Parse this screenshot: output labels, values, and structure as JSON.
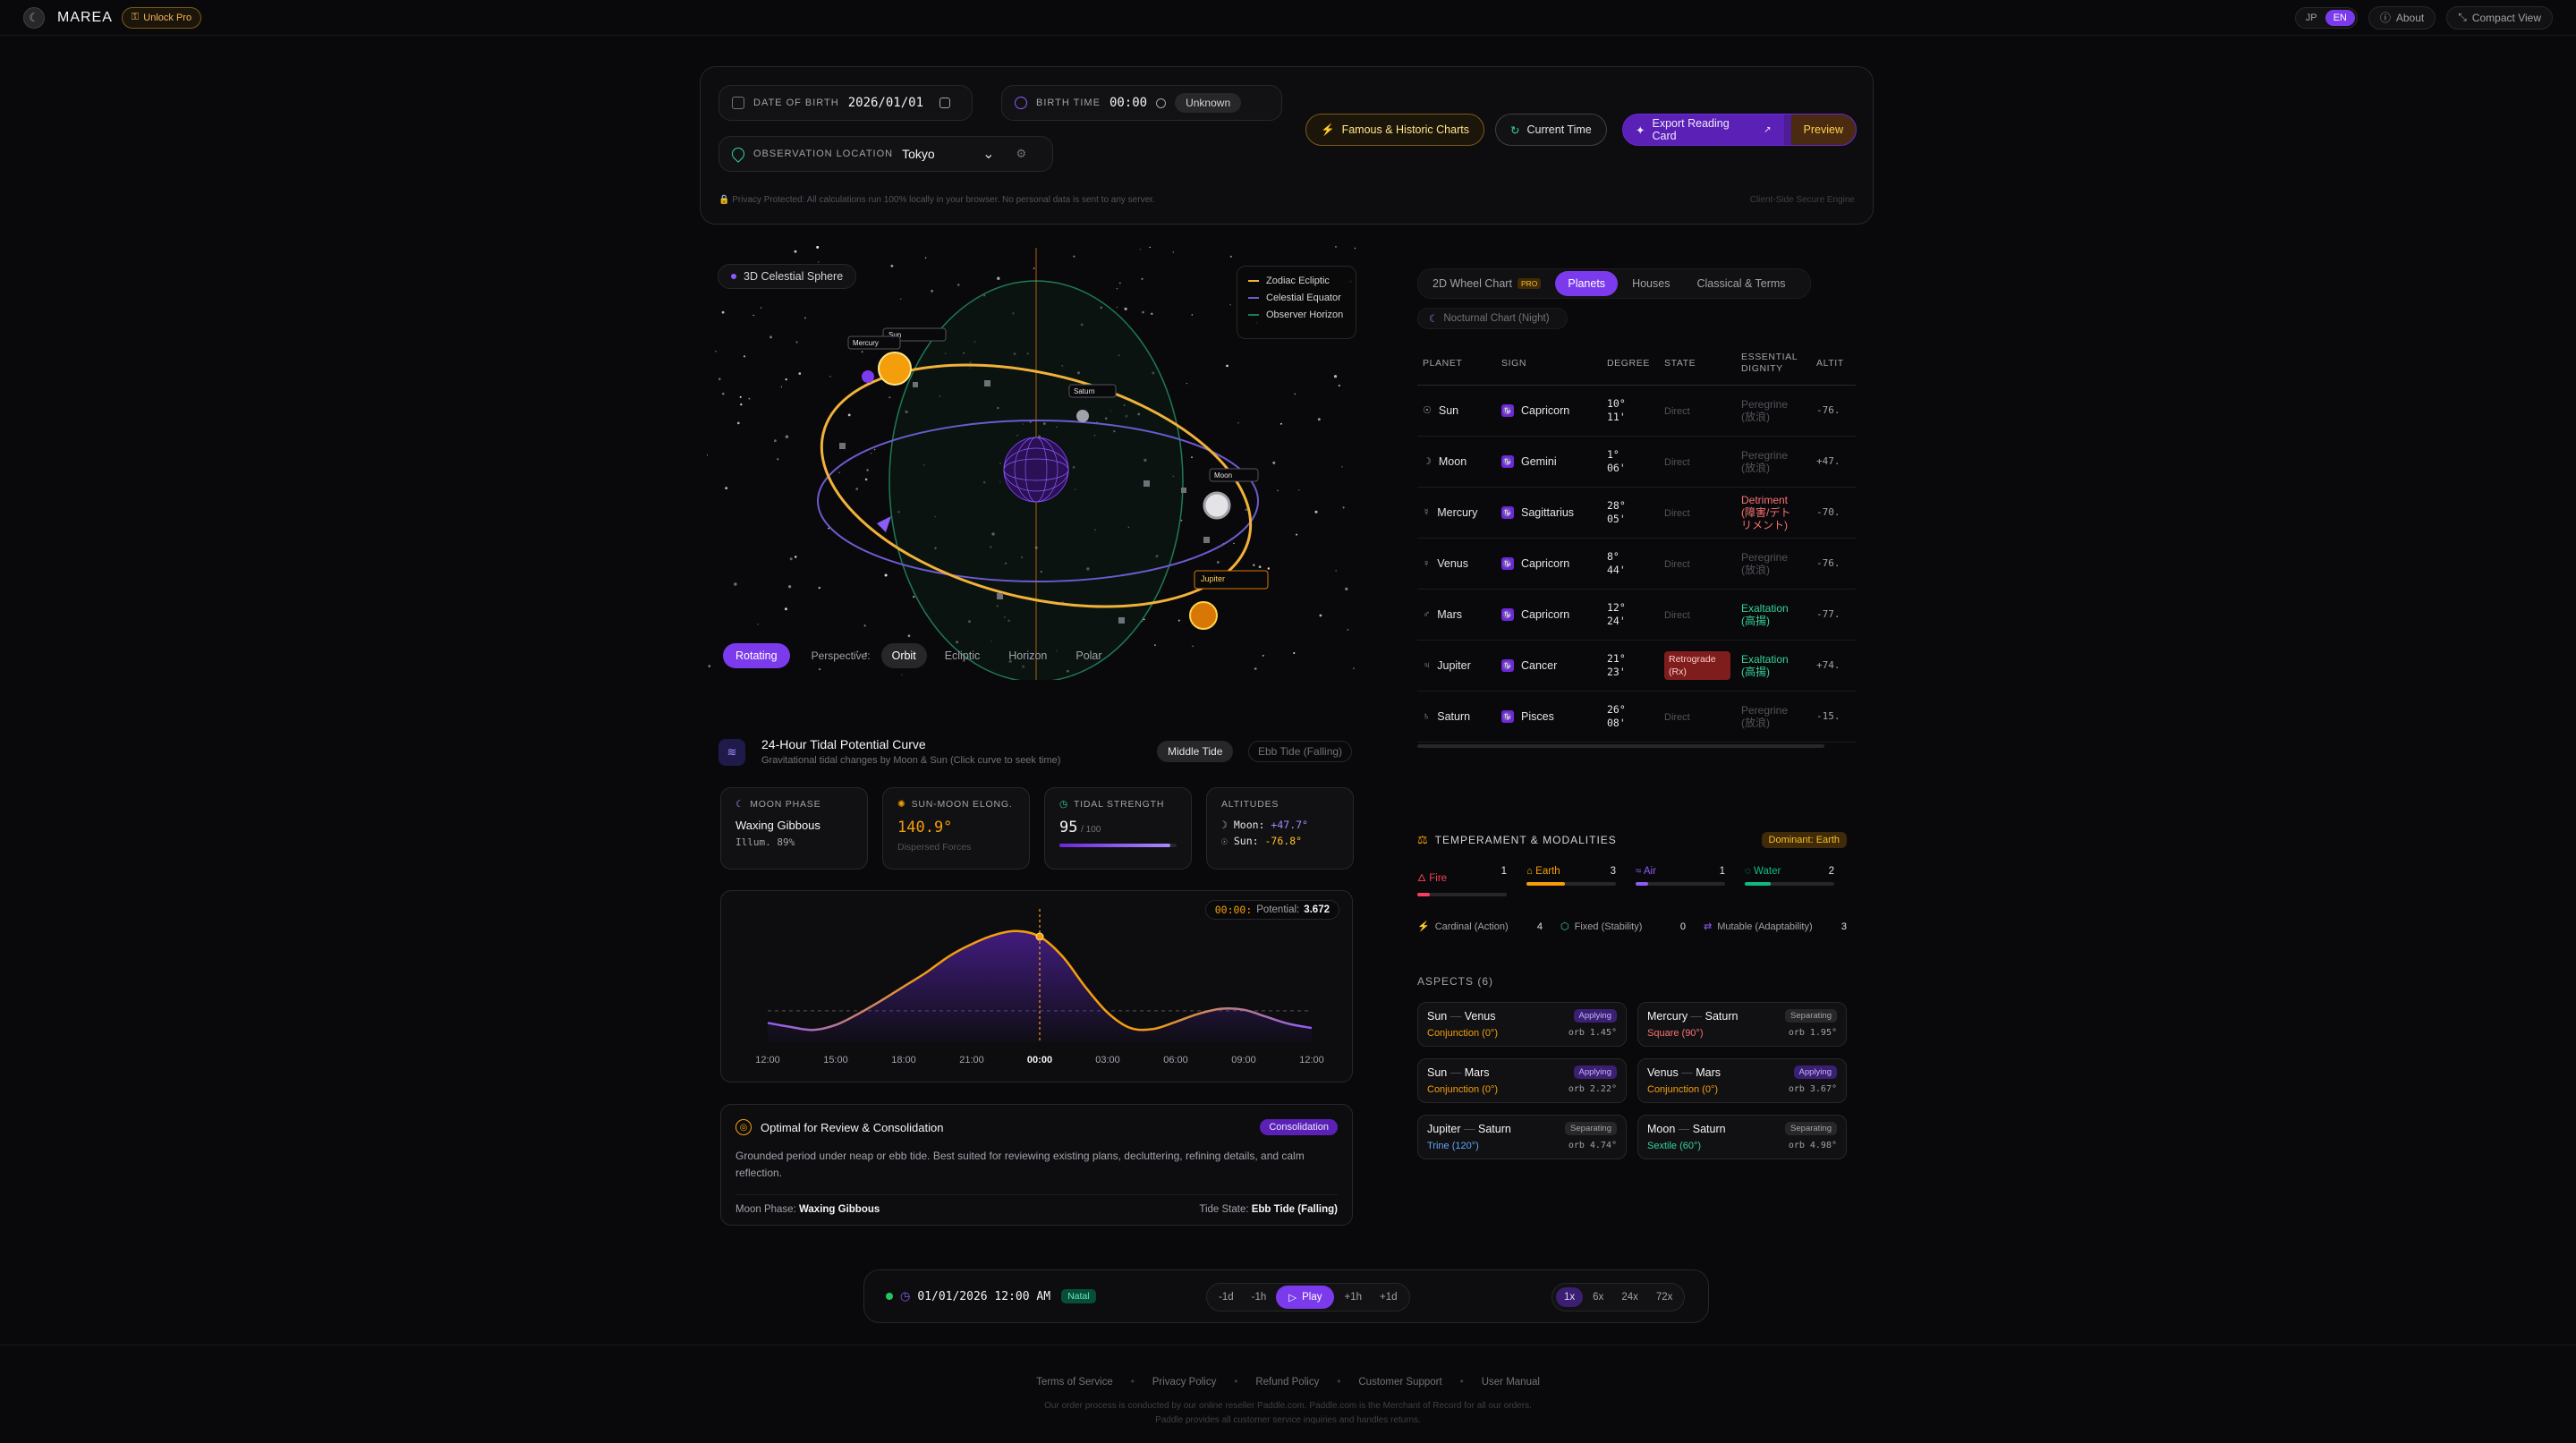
{
  "app": {
    "brand": "MAREA",
    "unlock": "Unlock Pro"
  },
  "topnav": {
    "lang_jp": "JP",
    "lang_en": "EN",
    "about": "About",
    "compact": "Compact View"
  },
  "controls": {
    "dob_label": "DATE OF BIRTH",
    "dob_value": "2026/01/01",
    "birthtime_label": "BIRTH TIME",
    "birthtime_value": "00:00",
    "unknown": "Unknown",
    "location_label": "OBSERVATION LOCATION",
    "location_value": "Tokyo",
    "famous": "Famous & Historic Charts",
    "current_time": "Current Time",
    "export": "Export Reading Card",
    "preview": "Preview",
    "privacy": "Privacy Protected: All calculations run 100% locally in your browser. No personal data is sent to any server.",
    "engine": "Client-Side Secure Engine"
  },
  "sphere": {
    "title": "3D Celestial Sphere",
    "legend": [
      "Zodiac Ecliptic",
      "Celestial Equator",
      "Observer Horizon"
    ],
    "rotating": "Rotating",
    "perspective": "Perspective:",
    "views": [
      "Orbit",
      "Ecliptic",
      "Horizon",
      "Polar"
    ],
    "labels": {
      "sun": "Sun",
      "mercury": "Mercury",
      "saturn": "Saturn",
      "moon": "Moon",
      "jupiter": "Jupiter"
    }
  },
  "tidal": {
    "title": "24-Hour Tidal Potential Curve",
    "subtitle": "Gravitational tidal changes by Moon & Sun (Click curve to seek time)",
    "middle_tide": "Middle Tide",
    "ebb_tide": "Ebb Tide (Falling)",
    "moon_phase_label": "MOON PHASE",
    "moon_phase": "Waxing Gibbous",
    "illum": "Illum. 89%",
    "elong_label": "SUN-MOON ELONG.",
    "elong": "140.9°",
    "elong_sub": "Dispersed Forces",
    "strength_label": "TIDAL STRENGTH",
    "strength": "95",
    "strength_unit": "/ 100",
    "strength_value": 0.95,
    "alt_label": "ALTITUDES",
    "alt_moon_label": "Moon:",
    "alt_moon": "+47.7°",
    "alt_sun_label": "Sun:",
    "alt_sun": "-76.8°",
    "readout_time": "00:00:",
    "readout_label": "Potential:",
    "readout_value": "3.672"
  },
  "chart_data": {
    "type": "line",
    "title": "",
    "xlabel": "",
    "ylabel": "",
    "x": [
      "12:00",
      "13:00",
      "14:00",
      "15:00",
      "16:00",
      "17:00",
      "18:00",
      "19:00",
      "20:00",
      "21:00",
      "22:00",
      "23:00",
      "00:00",
      "01:00",
      "02:00",
      "03:00",
      "04:00",
      "05:00",
      "06:00",
      "07:00",
      "08:00",
      "09:00",
      "10:00",
      "11:00",
      "12:00"
    ],
    "tick_labels": [
      "12:00",
      "15:00",
      "18:00",
      "21:00",
      "00:00",
      "03:00",
      "06:00",
      "09:00",
      "12:00"
    ],
    "series": [
      {
        "values": [
          -0.6,
          -0.8,
          -0.95,
          -0.7,
          -0.15,
          0.5,
          1.2,
          1.9,
          2.7,
          3.3,
          3.75,
          3.95,
          3.67,
          2.7,
          1.2,
          -0.1,
          -0.85,
          -0.9,
          -0.55,
          -0.15,
          0.1,
          0.05,
          -0.3,
          -0.65,
          -0.85
        ]
      }
    ],
    "current_x": "00:00",
    "ylim": [
      -1.6,
      4.6
    ],
    "grid": false
  },
  "insight": {
    "title": "Optimal for Review & Consolidation",
    "badge": "Consolidation",
    "body": "Grounded period under neap or ebb tide. Best suited for reviewing existing plans, decluttering, refining details, and calm reflection.",
    "moon_phase_label": "Moon Phase:",
    "moon_phase": "Waxing Gibbous",
    "tide_state_label": "Tide State:",
    "tide_state": "Ebb Tide (Falling)"
  },
  "right": {
    "tabs": [
      "2D Wheel Chart",
      "Planets",
      "Houses",
      "Classical & Terms"
    ],
    "pro": "PRO",
    "nocturnal": "Nocturnal Chart (Night)",
    "headers": [
      "PLANET",
      "SIGN",
      "DEGREE",
      "STATE",
      "ESSENTIAL DIGNITY",
      "ALTIT"
    ],
    "planets": [
      {
        "glyph": "☉",
        "name": "Sun",
        "sign": "Capricorn",
        "deg1": "10°",
        "deg2": "11'",
        "state": "Direct",
        "dignity": "Peregrine (放浪)",
        "alt": "-76."
      },
      {
        "glyph": "☽",
        "name": "Moon",
        "sign": "Gemini",
        "deg1": "1°",
        "deg2": "06'",
        "state": "Direct",
        "dignity": "Peregrine (放浪)",
        "alt": "+47."
      },
      {
        "glyph": "☿",
        "name": "Mercury",
        "sign": "Sagittarius",
        "deg1": "28°",
        "deg2": "05'",
        "state": "Direct",
        "dignity": "Detriment (障害/デトリメント)",
        "alt": "-70."
      },
      {
        "glyph": "♀",
        "name": "Venus",
        "sign": "Capricorn",
        "deg1": "8°",
        "deg2": "44'",
        "state": "Direct",
        "dignity": "Peregrine (放浪)",
        "alt": "-76."
      },
      {
        "glyph": "♂",
        "name": "Mars",
        "sign": "Capricorn",
        "deg1": "12°",
        "deg2": "24'",
        "state": "Direct",
        "dignity": "Exaltation (高揚)",
        "alt": "-77."
      },
      {
        "glyph": "♃",
        "name": "Jupiter",
        "sign": "Cancer",
        "deg1": "21°",
        "deg2": "23'",
        "state": "Retrograde (Rx)",
        "dignity": "Exaltation (高揚)",
        "alt": "+74."
      },
      {
        "glyph": "♄",
        "name": "Saturn",
        "sign": "Pisces",
        "deg1": "26°",
        "deg2": "08'",
        "state": "Direct",
        "dignity": "Peregrine (放浪)",
        "alt": "-15."
      }
    ],
    "temperament_title": "TEMPERAMENT & MODALITIES",
    "dominant": "Dominant: Earth",
    "elements": [
      {
        "name": "Fire",
        "count": "1",
        "value": 0.14,
        "color": "#f43f5e"
      },
      {
        "name": "Earth",
        "count": "3",
        "value": 0.43,
        "color": "#f59e0b"
      },
      {
        "name": "Air",
        "count": "1",
        "value": 0.14,
        "color": "#8b5cf6"
      },
      {
        "name": "Water",
        "count": "2",
        "value": 0.29,
        "color": "#10b981"
      }
    ],
    "modalities": [
      {
        "name": "Cardinal (Action)",
        "count": "4"
      },
      {
        "name": "Fixed (Stability)",
        "count": "0"
      },
      {
        "name": "Mutable (Adaptability)",
        "count": "3"
      }
    ],
    "aspects_title": "ASPECTS (6)",
    "aspects": [
      {
        "p1": "Sun",
        "p2": "Venus",
        "tag": "Applying",
        "type": "Conjunction (0°)",
        "orb": "orb 1.45°"
      },
      {
        "p1": "Mercury",
        "p2": "Saturn",
        "tag": "Separating",
        "type": "Square (90°)",
        "orb": "orb 1.95°"
      },
      {
        "p1": "Sun",
        "p2": "Mars",
        "tag": "Applying",
        "type": "Conjunction (0°)",
        "orb": "orb 2.22°"
      },
      {
        "p1": "Venus",
        "p2": "Mars",
        "tag": "Applying",
        "type": "Conjunction (0°)",
        "orb": "orb 3.67°"
      },
      {
        "p1": "Jupiter",
        "p2": "Saturn",
        "tag": "Separating",
        "type": "Trine (120°)",
        "orb": "orb 4.74°"
      },
      {
        "p1": "Moon",
        "p2": "Saturn",
        "tag": "Separating",
        "type": "Sextile (60°)",
        "orb": "orb 4.98°"
      }
    ]
  },
  "timebar": {
    "datetime": "01/01/2026 12:00 AM",
    "natal": "Natal",
    "steps": [
      "-1d",
      "-1h",
      "Play",
      "+1h",
      "+1d"
    ],
    "speeds": [
      "1x",
      "6x",
      "24x",
      "72x"
    ]
  },
  "footer": {
    "links": [
      "Terms of Service",
      "Privacy Policy",
      "Refund Policy",
      "Customer Support",
      "User Manual"
    ],
    "line1": "Our order process is conducted by our online reseller Paddle.com. Paddle.com is the Merchant of Record for all our orders.",
    "line2": "Paddle provides all customer service inquiries and handles returns."
  },
  "colors": {
    "accent": "#7c3aed",
    "gold": "#f59e0b",
    "green": "#34d399",
    "red": "#f87171"
  }
}
